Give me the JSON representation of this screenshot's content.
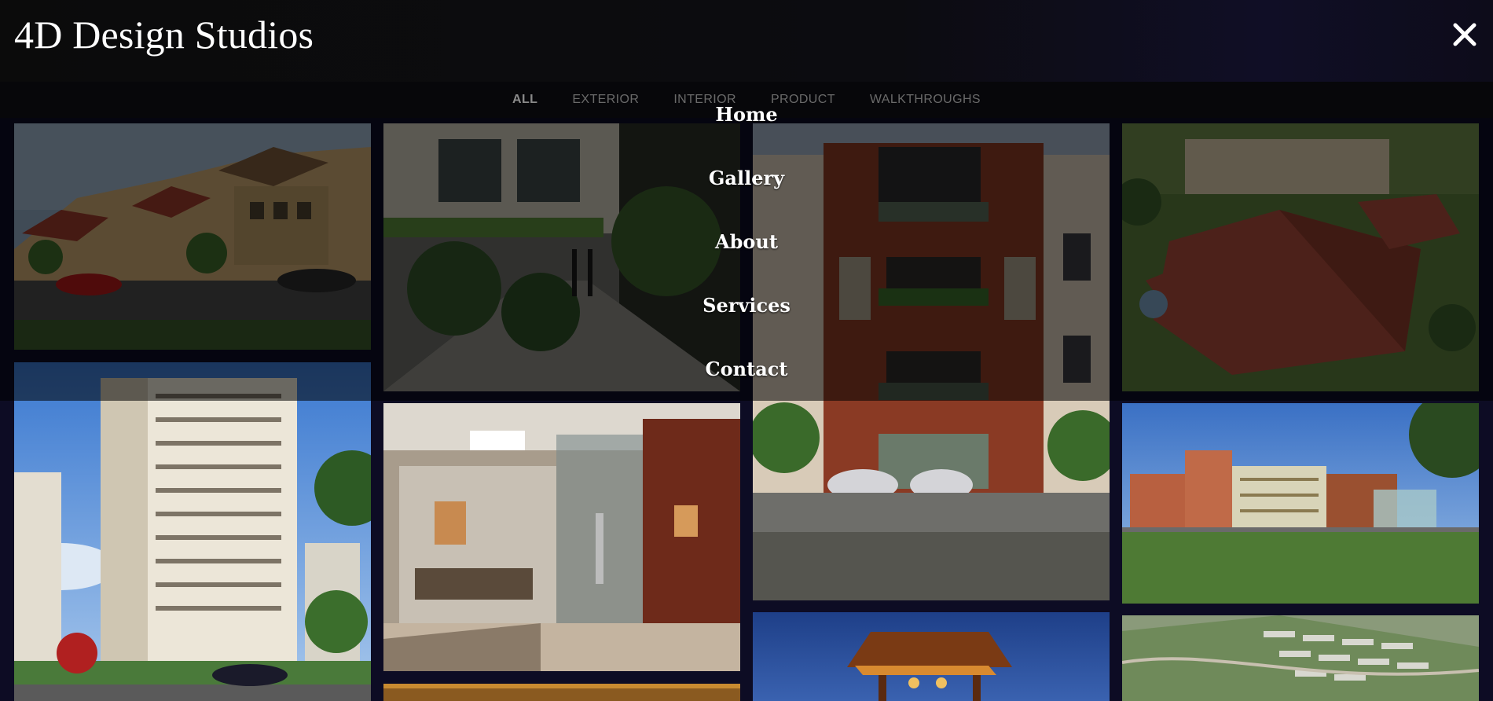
{
  "header": {
    "brand": "4D Design Studios",
    "close_icon": "close-icon"
  },
  "filters": [
    {
      "label": "ALL",
      "active": true
    },
    {
      "label": "EXTERIOR",
      "active": false
    },
    {
      "label": "INTERIOR",
      "active": false
    },
    {
      "label": "PRODUCT",
      "active": false
    },
    {
      "label": "WALKTHROUGHS",
      "active": false
    }
  ],
  "menu": {
    "items": [
      "Home",
      "Gallery",
      "About",
      "Services",
      "Contact"
    ]
  },
  "gallery": {
    "images": [
      "row-houses-exterior-render",
      "courtyard-walkway-render",
      "brick-apartment-facade-render",
      "aerial-campus-rooftops-render",
      "highrise-tower-render",
      "office-cabin-interior-render",
      "campus-buildings-lawn-render",
      "pergola-dusk-render",
      "aerial-township-layout-render",
      "interior-render-partial"
    ]
  },
  "colors": {
    "background": "#0d0c24",
    "header_bg": "#0b0b0b",
    "text": "#ffffff",
    "filter_inactive": "#6a6a6a",
    "filter_active": "#8a8a8a"
  }
}
